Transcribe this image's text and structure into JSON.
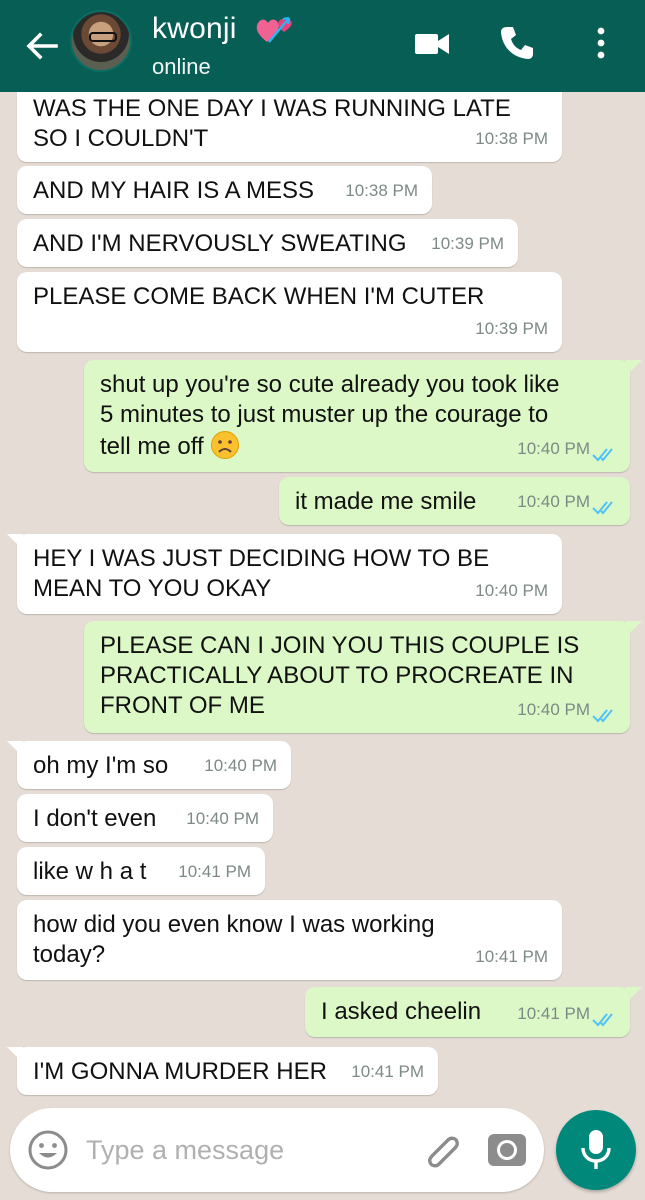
{
  "header": {
    "contact_name": "kwonji",
    "status": "online",
    "heart_icon": "revolving-heart-emoji"
  },
  "messages": [
    {
      "direction": "in",
      "text": "WAS THE ONE DAY I WAS RUNNING LATE\nSO I COULDN'T",
      "time": "10:38 PM"
    },
    {
      "direction": "in",
      "text": "AND MY HAIR IS A MESS",
      "time": "10:38 PM"
    },
    {
      "direction": "in",
      "text": "AND I'M NERVOUSLY SWEATING",
      "time": "10:39 PM"
    },
    {
      "direction": "in",
      "text": "PLEASE COME BACK WHEN I'M CUTER",
      "time": "10:39 PM"
    },
    {
      "direction": "out",
      "text": "shut up you're so cute already you took like\n5 minutes to just muster up the courage to\ntell me off",
      "time": "10:40 PM",
      "emoji": "frowning-face",
      "read": true
    },
    {
      "direction": "out",
      "text": "it made me smile",
      "time": "10:40 PM",
      "read": true
    },
    {
      "direction": "in",
      "text": "HEY I WAS JUST DECIDING HOW TO BE\nMEAN TO YOU OKAY",
      "time": "10:40 PM"
    },
    {
      "direction": "out",
      "text": "PLEASE CAN I JOIN YOU THIS COUPLE IS\nPRACTICALLY ABOUT TO PROCREATE IN\nFRONT OF ME",
      "time": "10:40 PM",
      "read": true
    },
    {
      "direction": "in",
      "text": "oh my I'm so",
      "time": "10:40 PM"
    },
    {
      "direction": "in",
      "text": "I don't even",
      "time": "10:40 PM"
    },
    {
      "direction": "in",
      "text": "like w h a t",
      "time": "10:41 PM"
    },
    {
      "direction": "in",
      "text": "how did you even know I was working\ntoday?",
      "time": "10:41 PM"
    },
    {
      "direction": "out",
      "text": "I asked cheelin",
      "time": "10:41 PM",
      "read": true
    },
    {
      "direction": "in",
      "text": "I'M GONNA MURDER HER",
      "time": "10:41 PM"
    }
  ],
  "composer": {
    "placeholder": "Type a message"
  },
  "colors": {
    "header": "#075e54",
    "chat_bg": "#e5ddd5",
    "incoming": "#ffffff",
    "outgoing": "#dcf8c6",
    "read_ticks": "#4fc3f7",
    "fab": "#00897b"
  }
}
